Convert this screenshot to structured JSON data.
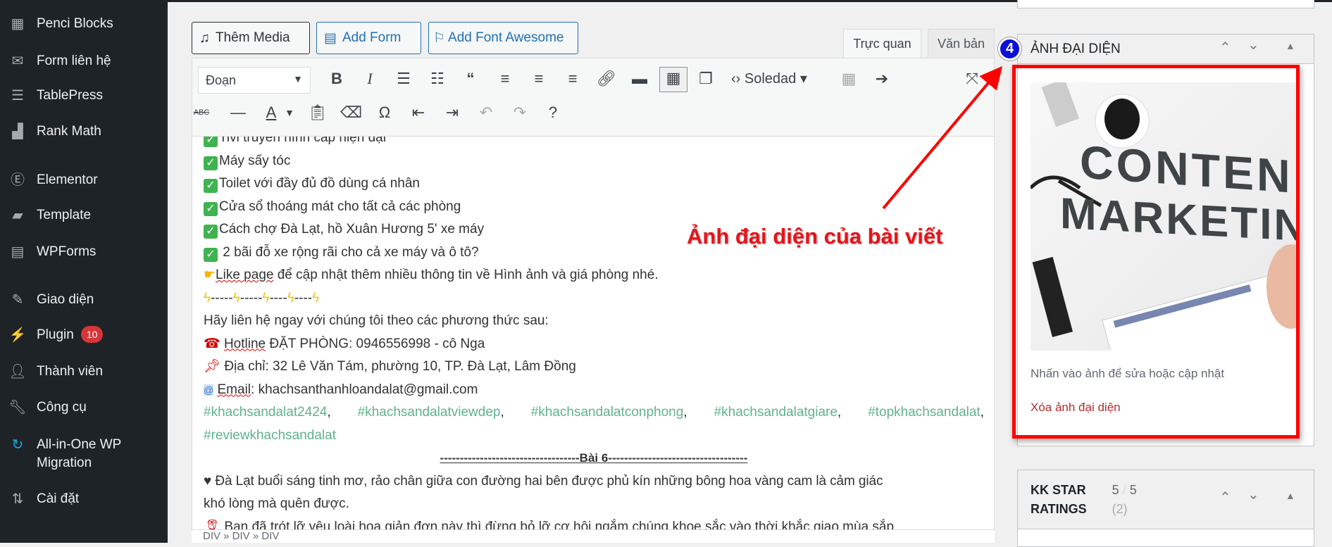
{
  "sidebar": {
    "items": [
      {
        "label": "Penci Blocks",
        "icon": "blocks-icon"
      },
      {
        "label": "Form liên hệ",
        "icon": "mail-icon"
      },
      {
        "label": "TablePress",
        "icon": "table-icon"
      },
      {
        "label": "Rank Math",
        "icon": "chart-icon"
      },
      {
        "label": "Elementor",
        "icon": "elementor-icon"
      },
      {
        "label": "Template",
        "icon": "folder-icon"
      },
      {
        "label": "WPForms",
        "icon": "forms-icon"
      },
      {
        "label": "Giao diện",
        "icon": "brush-icon"
      },
      {
        "label": "Plugin",
        "icon": "plugin-icon",
        "badge": "10"
      },
      {
        "label": "Thành viên",
        "icon": "user-icon"
      },
      {
        "label": "Công cụ",
        "icon": "wrench-icon"
      },
      {
        "label": "All-in-One WP",
        "label2": "Migration",
        "icon": "migration-icon"
      },
      {
        "label": "Cài đặt",
        "icon": "settings-icon"
      }
    ]
  },
  "media_buttons": {
    "add_media": "Thêm Media",
    "add_form": "Add Form",
    "add_font_awesome": "Add Font Awesome"
  },
  "tabs": {
    "visual": "Trực quan",
    "text": "Văn bản"
  },
  "toolbar": {
    "format": "Đoạn",
    "soledad": "Soledad"
  },
  "content": {
    "lines": [
      "Tivi truyền hình cáp hiện đại",
      "Máy sấy tóc",
      "Toilet với đầy đủ đồ dùng cá nhân",
      "Cửa sổ thoáng mát cho tất cả các phòng",
      "Cách chợ Đà Lạt, hồ Xuân Hương 5' xe máy",
      " 2 bãi đỗ xe rộng rãi cho cả xe máy và ô tô?"
    ],
    "like": {
      "word": "Like page",
      "rest": " để cập nhật thêm nhiều thông tin về Hình ảnh và giá phòng nhé."
    },
    "dashes": [
      "-----",
      "-----",
      "----",
      "----"
    ],
    "contact_intro": "Hãy liên hệ ngay với chúng tôi theo các phương thức sau:",
    "hotline": {
      "word": "Hotline",
      "rest": " ĐẶT PHÒNG: 0946556998 - cô Nga"
    },
    "address": " Địa chỉ: 32 Lê Văn Tám, phường 10, TP. Đà Lạt, Lâm Đồng",
    "email": {
      "word": "Email",
      "rest": ": khachsanthanhloandalat@gmail.com"
    },
    "hashtags": [
      "#khachsandalat2424",
      "#khachsandalatviewdep",
      "#khachsandalatconphong",
      "#khachsandalatgiare",
      "#topkhachsandalat",
      "#reviewkhachsandalat"
    ],
    "section": "-----------------------------------Bài 6-----------------------------------",
    "para1a": "♥ Đà Lạt buổi sáng tinh mơ, rảo chân giữa con đường hai bên được phủ kín những bông hoa vàng cam là cảm giác",
    "para1b": "khó lòng mà quên được.",
    "para2": " Bạn đã trót lỡ yêu loài hoa giản đơn này thì đừng bỏ lỡ cơ hội ngắm chúng khoe sắc vào thời khắc giao mùa sắp"
  },
  "status_path": "DIV » DIV » DIV",
  "featured": {
    "title": "ẢNH ĐẠI DIỆN",
    "image_text1": "CONTEN",
    "image_text2": "MARKETIN",
    "hint": "Nhấn vào ảnh để sửa hoặc cập nhật",
    "remove": "Xóa ảnh đại diện"
  },
  "kk": {
    "title1": "KK STAR",
    "title2": "RATINGS",
    "score": "5",
    "sep": "/",
    "max": "5",
    "count": "(2)"
  },
  "annotation": {
    "number": "4",
    "text": "Ảnh đại diện của bài viết",
    "color": "#ff0000"
  }
}
